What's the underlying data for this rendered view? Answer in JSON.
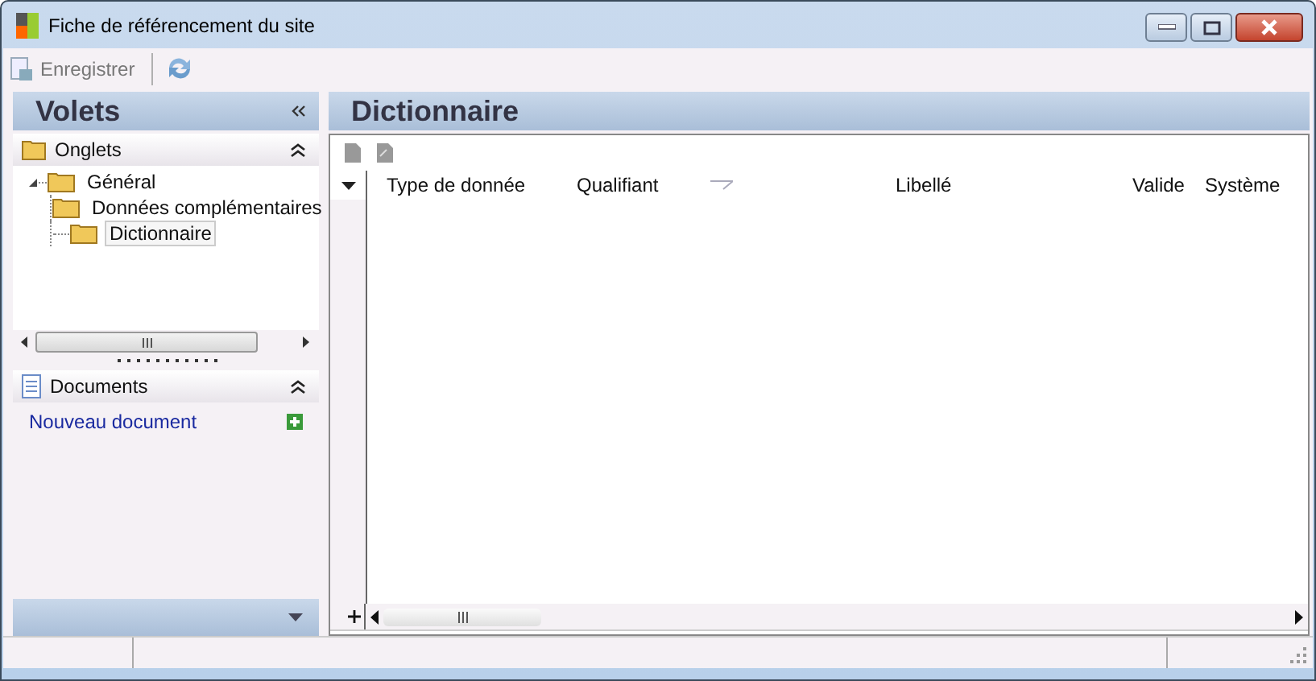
{
  "window": {
    "title": "Fiche de référencement du site"
  },
  "toolbar": {
    "items": [
      {
        "kind": "button",
        "label": "Enregistrer",
        "disabled": true
      },
      {
        "kind": "refresh"
      }
    ]
  },
  "sidebar": {
    "title": "Volets",
    "sections": [
      {
        "kind": "tree",
        "title": "Onglets",
        "expanded": true,
        "tree": [
          {
            "label": "Général",
            "expanded": true,
            "selected": false,
            "children": [
              {
                "label": "Données complémentaires",
                "selected": false
              },
              {
                "label": "Dictionnaire",
                "selected": true
              }
            ]
          }
        ]
      },
      {
        "kind": "links",
        "title": "Documents",
        "expanded": true,
        "links": [
          "Nouveau document"
        ]
      }
    ]
  },
  "main": {
    "title": "Dictionnaire",
    "table": {
      "columns": [
        {
          "label": "Type de donnée",
          "filter": false
        },
        {
          "label": "Qualifiant",
          "filter": true
        },
        {
          "label": "Libellé",
          "filter": false
        },
        {
          "label": "Valide",
          "filter": false
        },
        {
          "label": "Système",
          "filter": false
        }
      ]
    }
  }
}
